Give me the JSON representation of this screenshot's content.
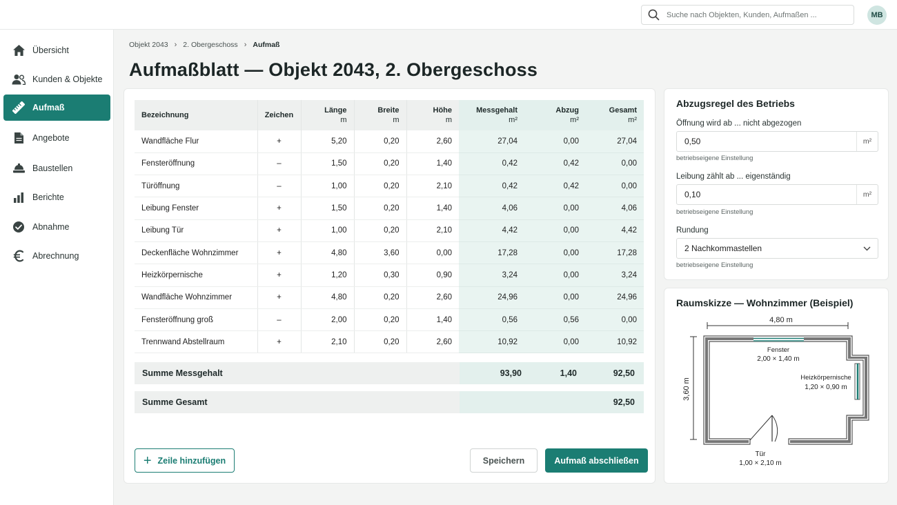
{
  "header": {
    "search_placeholder": "Suche nach Objekten, Kunden, Aufmaßen ...",
    "avatar_initials": "MB"
  },
  "sidebar": {
    "items": [
      {
        "label": "Übersicht",
        "icon": "home-icon",
        "active": false
      },
      {
        "label": "Kunden & Objekte",
        "icon": "users-icon",
        "active": false
      },
      {
        "label": "Aufmaß",
        "icon": "ruler-icon",
        "active": true
      },
      {
        "label": "Angebote",
        "icon": "document-icon",
        "active": false
      },
      {
        "label": "Baustellen",
        "icon": "construction-icon",
        "active": false
      },
      {
        "label": "Berichte",
        "icon": "bar-chart-icon",
        "active": false
      },
      {
        "label": "Abnahme",
        "icon": "check-circle-icon",
        "active": false
      },
      {
        "label": "Abrechnung",
        "icon": "euro-icon",
        "active": false
      }
    ]
  },
  "breadcrumb": [
    "Objekt 2043",
    "2. Obergeschoss",
    "Aufmaß"
  ],
  "page_title": "Aufmaßblatt — Objekt 2043, 2. Obergeschoss",
  "table": {
    "headers": {
      "bezeichnung": "Bezeichnung",
      "zeichen": "Zeichen",
      "laenge": "Länge",
      "breite": "Breite",
      "hoehe": "Höhe",
      "messgehalt": "Messgehalt",
      "abzug": "Abzug",
      "gesamt": "Gesamt",
      "unit_m": "m",
      "unit_m2": "m²"
    },
    "rows": [
      {
        "bezeichnung": "Wandfläche Flur",
        "zeichen": "+",
        "laenge": "5,20",
        "breite": "0,20",
        "hoehe": "2,60",
        "messgehalt": "27,04",
        "abzug": "0,00",
        "gesamt": "27,04"
      },
      {
        "bezeichnung": "Fensteröffnung",
        "zeichen": "–",
        "laenge": "1,50",
        "breite": "0,20",
        "hoehe": "1,40",
        "messgehalt": "0,42",
        "abzug": "0,42",
        "gesamt": "0,00"
      },
      {
        "bezeichnung": "Türöffnung",
        "zeichen": "–",
        "laenge": "1,00",
        "breite": "0,20",
        "hoehe": "2,10",
        "messgehalt": "0,42",
        "abzug": "0,42",
        "gesamt": "0,00"
      },
      {
        "bezeichnung": "Leibung Fenster",
        "zeichen": "+",
        "laenge": "1,50",
        "breite": "0,20",
        "hoehe": "1,40",
        "messgehalt": "4,06",
        "abzug": "0,00",
        "gesamt": "4,06"
      },
      {
        "bezeichnung": "Leibung Tür",
        "zeichen": "+",
        "laenge": "1,00",
        "breite": "0,20",
        "hoehe": "2,10",
        "messgehalt": "4,42",
        "abzug": "0,00",
        "gesamt": "4,42"
      },
      {
        "bezeichnung": "Deckenfläche Wohnzimmer",
        "zeichen": "+",
        "laenge": "4,80",
        "breite": "3,60",
        "hoehe": "0,00",
        "messgehalt": "17,28",
        "abzug": "0,00",
        "gesamt": "17,28"
      },
      {
        "bezeichnung": "Heizkörpernische",
        "zeichen": "+",
        "laenge": "1,20",
        "breite": "0,30",
        "hoehe": "0,90",
        "messgehalt": "3,24",
        "abzug": "0,00",
        "gesamt": "3,24"
      },
      {
        "bezeichnung": "Wandfläche Wohnzimmer",
        "zeichen": "+",
        "laenge": "4,80",
        "breite": "0,20",
        "hoehe": "2,60",
        "messgehalt": "24,96",
        "abzug": "0,00",
        "gesamt": "24,96"
      },
      {
        "bezeichnung": "Fensteröffnung groß",
        "zeichen": "–",
        "laenge": "2,00",
        "breite": "0,20",
        "hoehe": "1,40",
        "messgehalt": "0,56",
        "abzug": "0,56",
        "gesamt": "0,00"
      },
      {
        "bezeichnung": "Trennwand Abstellraum",
        "zeichen": "+",
        "laenge": "2,10",
        "breite": "0,20",
        "hoehe": "2,60",
        "messgehalt": "10,92",
        "abzug": "0,00",
        "gesamt": "10,92"
      }
    ],
    "sum_messgehalt": {
      "label": "Summe Messgehalt",
      "messgehalt": "93,90",
      "abzug": "1,40",
      "gesamt": "92,50"
    },
    "sum_gesamt": {
      "label": "Summe Gesamt",
      "gesamt": "92,50"
    }
  },
  "actions": {
    "add_row": "Zeile hinzufügen",
    "save": "Speichern",
    "finish": "Aufmaß abschließen"
  },
  "rules": {
    "title": "Abzugsregel des Betriebs",
    "opening_label": "Öffnung wird ab ...  nicht abgezogen",
    "opening_value": "0,50",
    "opening_unit": "m²",
    "opening_hint": "betriebseigene Einstellung",
    "reveal_label": "Leibung zählt ab ...  eigenständig",
    "reveal_value": "0,10",
    "reveal_unit": "m²",
    "reveal_hint": "betriebseigene Einstellung",
    "rounding_label": "Rundung",
    "rounding_value": "2 Nachkommastellen",
    "rounding_hint": "betriebseigene Einstellung"
  },
  "sketch": {
    "title": "Raumskizze — Wohnzimmer (Beispiel)",
    "width_label": "4,80 m",
    "height_label": "3,60 m",
    "window_label": "Fenster",
    "window_dims": "2,00 × 1,40 m",
    "niche_label": "Heizkörpernische",
    "niche_dims": "1,20 × 0,90 m",
    "door_label": "Tür",
    "door_dims": "1,00 × 2,10 m",
    "accent_color": "#1b7d73"
  }
}
